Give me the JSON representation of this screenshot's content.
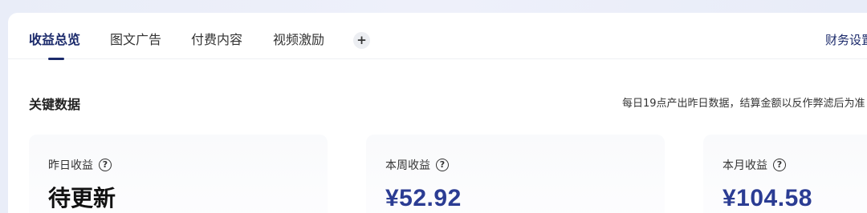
{
  "tabs": [
    {
      "label": "收益总览",
      "active": true
    },
    {
      "label": "图文广告",
      "active": false
    },
    {
      "label": "付费内容",
      "active": false
    },
    {
      "label": "视频激励",
      "active": false
    }
  ],
  "add_tab_label": "+",
  "finance_settings_label": "财务设置",
  "key_data": {
    "title": "关键数据",
    "note": "每日19点产出昨日数据，结算金额以反作弊滤后为准"
  },
  "stats": [
    {
      "label": "昨日收益",
      "value": "待更新"
    },
    {
      "label": "本周收益",
      "value": "¥52.92"
    },
    {
      "label": "本月收益",
      "value": "¥104.58"
    }
  ],
  "help_icon_glyph": "?",
  "colors": {
    "accent": "#1b2a6b",
    "money": "#2b3c93",
    "background": "#eaeef9"
  }
}
